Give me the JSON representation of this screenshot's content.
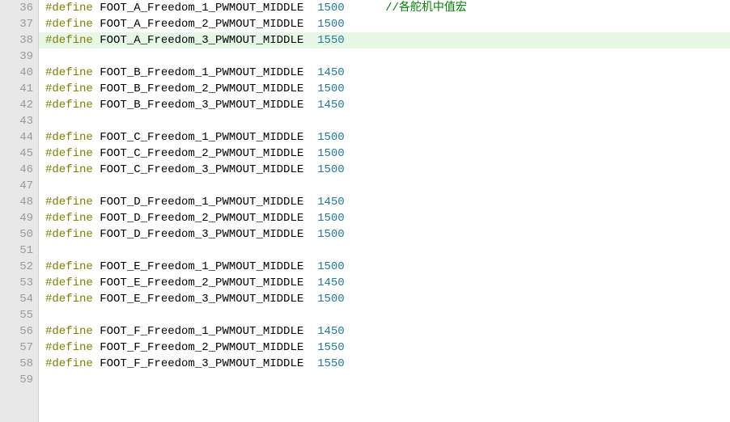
{
  "code": {
    "first_line": 36,
    "highlighted_line": 38,
    "lines": [
      {
        "n": 36,
        "dir": "#define",
        "id": "FOOT_A_Freedom_1_PWMOUT_MIDDLE",
        "val": "1500",
        "cmt": "//各舵机中值宏"
      },
      {
        "n": 37,
        "dir": "#define",
        "id": "FOOT_A_Freedom_2_PWMOUT_MIDDLE",
        "val": "1500"
      },
      {
        "n": 38,
        "dir": "#define",
        "id": "FOOT_A_Freedom_3_PWMOUT_MIDDLE",
        "val": "1550"
      },
      {
        "n": 39
      },
      {
        "n": 40,
        "dir": "#define",
        "id": "FOOT_B_Freedom_1_PWMOUT_MIDDLE",
        "val": "1450"
      },
      {
        "n": 41,
        "dir": "#define",
        "id": "FOOT_B_Freedom_2_PWMOUT_MIDDLE",
        "val": "1500"
      },
      {
        "n": 42,
        "dir": "#define",
        "id": "FOOT_B_Freedom_3_PWMOUT_MIDDLE",
        "val": "1450"
      },
      {
        "n": 43
      },
      {
        "n": 44,
        "dir": "#define",
        "id": "FOOT_C_Freedom_1_PWMOUT_MIDDLE",
        "val": "1500"
      },
      {
        "n": 45,
        "dir": "#define",
        "id": "FOOT_C_Freedom_2_PWMOUT_MIDDLE",
        "val": "1500"
      },
      {
        "n": 46,
        "dir": "#define",
        "id": "FOOT_C_Freedom_3_PWMOUT_MIDDLE",
        "val": "1500"
      },
      {
        "n": 47
      },
      {
        "n": 48,
        "dir": "#define",
        "id": "FOOT_D_Freedom_1_PWMOUT_MIDDLE",
        "val": "1450"
      },
      {
        "n": 49,
        "dir": "#define",
        "id": "FOOT_D_Freedom_2_PWMOUT_MIDDLE",
        "val": "1500"
      },
      {
        "n": 50,
        "dir": "#define",
        "id": "FOOT_D_Freedom_3_PWMOUT_MIDDLE",
        "val": "1500"
      },
      {
        "n": 51
      },
      {
        "n": 52,
        "dir": "#define",
        "id": "FOOT_E_Freedom_1_PWMOUT_MIDDLE",
        "val": "1500"
      },
      {
        "n": 53,
        "dir": "#define",
        "id": "FOOT_E_Freedom_2_PWMOUT_MIDDLE",
        "val": "1450"
      },
      {
        "n": 54,
        "dir": "#define",
        "id": "FOOT_E_Freedom_3_PWMOUT_MIDDLE",
        "val": "1500"
      },
      {
        "n": 55
      },
      {
        "n": 56,
        "dir": "#define",
        "id": "FOOT_F_Freedom_1_PWMOUT_MIDDLE",
        "val": "1450"
      },
      {
        "n": 57,
        "dir": "#define",
        "id": "FOOT_F_Freedom_2_PWMOUT_MIDDLE",
        "val": "1550"
      },
      {
        "n": 58,
        "dir": "#define",
        "id": "FOOT_F_Freedom_3_PWMOUT_MIDDLE",
        "val": "1550"
      },
      {
        "n": 59
      }
    ]
  }
}
